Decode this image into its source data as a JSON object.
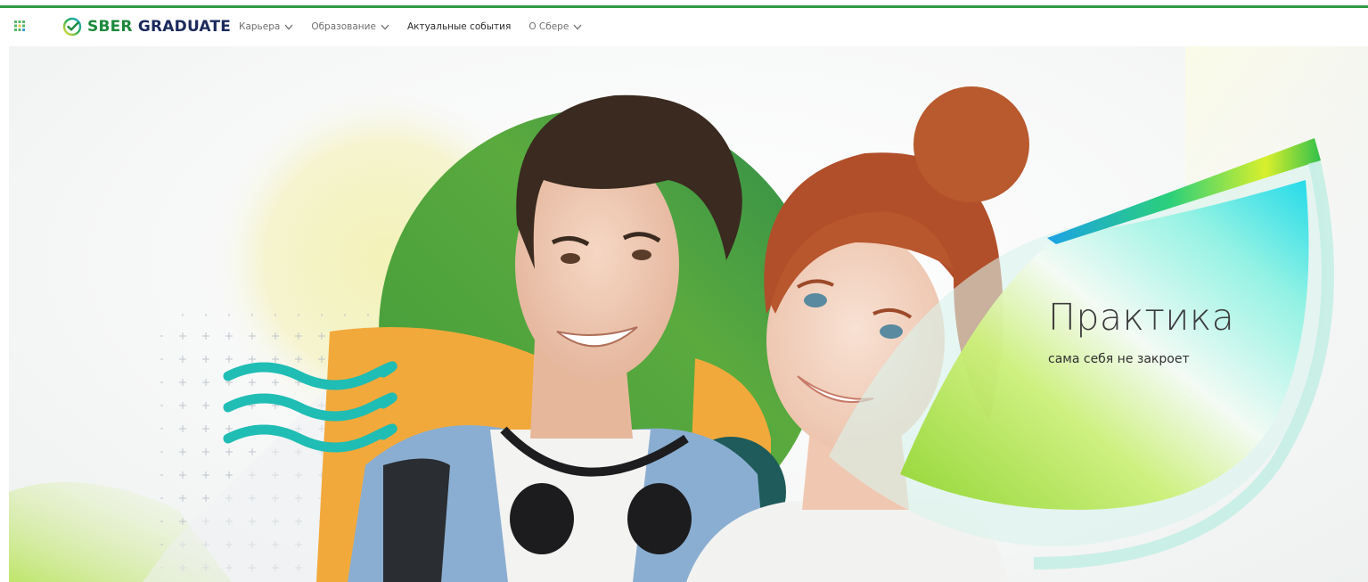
{
  "brand": {
    "logo_icon": "sber-check-icon",
    "name_part1": "SBER",
    "name_part2": "GRADUATE",
    "color_green": "#1c8a3c",
    "color_navy": "#1b2a5c"
  },
  "nav": {
    "items": [
      {
        "label": "Карьера",
        "has_dropdown": true
      },
      {
        "label": "Образование",
        "has_dropdown": true
      },
      {
        "label": "Актуальные события",
        "has_dropdown": false
      },
      {
        "label": "О Сбере",
        "has_dropdown": true
      }
    ]
  },
  "hero": {
    "title": "Практика",
    "subtitle": "сама себя не закроет",
    "accent_green": "#2e9c43",
    "accent_teal": "#1fbdb4",
    "accent_orange": "#f2a93b"
  },
  "icons": {
    "apps": "grid-icon",
    "dropdown": "chevron-down-icon"
  }
}
